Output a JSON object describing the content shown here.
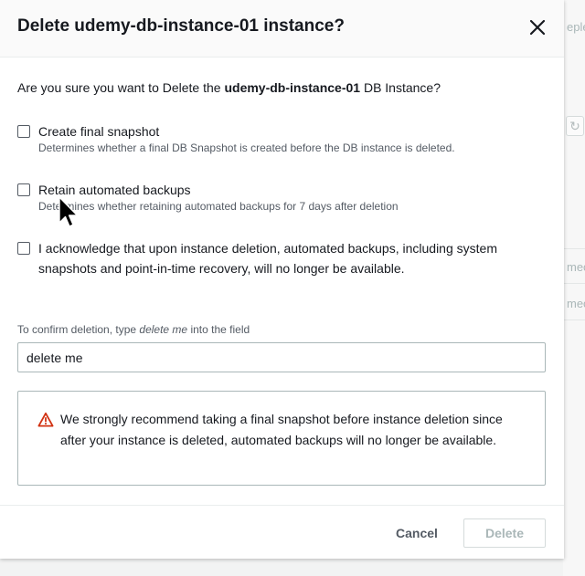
{
  "background": {
    "text_1": "eple",
    "text_2": "mec",
    "text_3": "mec"
  },
  "modal": {
    "title": "Delete udemy-db-instance-01 instance?",
    "question_prefix": "Are you sure you want to Delete the ",
    "question_instance": "udemy-db-instance-01",
    "question_suffix": " DB Instance?",
    "options": [
      {
        "label": "Create final snapshot",
        "description": "Determines whether a final DB Snapshot is created before the DB instance is deleted.",
        "checked": false
      },
      {
        "label": "Retain automated backups",
        "description": "Determines whether retaining automated backups for 7 days after deletion",
        "checked": false
      }
    ],
    "acknowledge": {
      "label": "I acknowledge that upon instance deletion, automated backups, including system snapshots and point-in-time recovery, will no longer be available.",
      "checked": false
    },
    "confirm": {
      "label_prefix": "To confirm deletion, type ",
      "label_keyword": "delete me",
      "label_suffix": " into the field",
      "value": "delete me"
    },
    "warning": {
      "icon": "warning-triangle-icon",
      "text": "We strongly recommend taking a final snapshot before instance deletion since after your instance is deleted, automated backups will no longer be available."
    },
    "footer": {
      "cancel_label": "Cancel",
      "delete_label": "Delete",
      "delete_disabled": true
    }
  },
  "colors": {
    "warning": "#d13212",
    "text": "#16191f",
    "muted": "#545b64"
  }
}
